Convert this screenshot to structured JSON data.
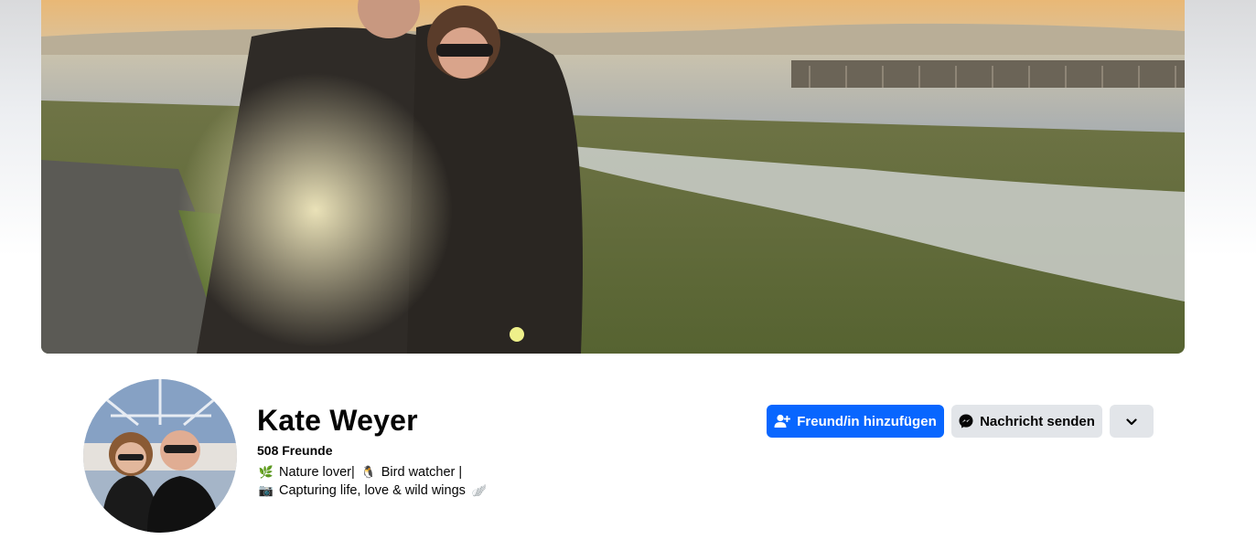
{
  "profile": {
    "name": "Kate Weyer",
    "friends": "508 Freunde",
    "bio": {
      "line1_part1": "Nature lover|",
      "line1_part2": "Bird watcher |",
      "line2": "Capturing life, love & wild wings"
    }
  },
  "icons": {
    "bio_emoji_1": "seedling-icon",
    "bio_emoji_2": "penguin-icon",
    "bio_emoji_3": "camera-icon",
    "bio_emoji_4": "wing-icon"
  },
  "actions": {
    "add_friend": "Freund/in hinzufügen",
    "message": "Nachricht senden"
  },
  "colors": {
    "primary": "#0866ff",
    "secondary": "#e2e5e9"
  }
}
